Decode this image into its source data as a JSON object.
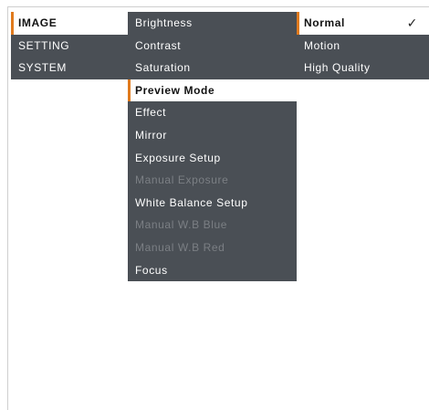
{
  "main_menu": {
    "items": [
      {
        "label": "IMAGE",
        "state": "selected"
      },
      {
        "label": "SETTING",
        "state": "normal"
      },
      {
        "label": "SYSTEM",
        "state": "normal"
      }
    ]
  },
  "image_menu": {
    "items": [
      {
        "label": "Brightness",
        "state": "normal"
      },
      {
        "label": "Contrast",
        "state": "normal"
      },
      {
        "label": "Saturation",
        "state": "normal"
      },
      {
        "label": "Preview Mode",
        "state": "selected"
      },
      {
        "label": "Effect",
        "state": "normal"
      },
      {
        "label": "Mirror",
        "state": "normal"
      },
      {
        "label": "Exposure Setup",
        "state": "normal"
      },
      {
        "label": "Manual Exposure",
        "state": "disabled"
      },
      {
        "label": "White Balance Setup",
        "state": "normal"
      },
      {
        "label": "Manual W.B Blue",
        "state": "disabled"
      },
      {
        "label": "Manual W.B Red",
        "state": "disabled"
      },
      {
        "label": "Focus",
        "state": "normal"
      }
    ]
  },
  "preview_menu": {
    "items": [
      {
        "label": "Normal",
        "state": "selected",
        "checked": true
      },
      {
        "label": "Motion",
        "state": "normal"
      },
      {
        "label": "High Quality",
        "state": "normal"
      }
    ],
    "check_glyph": "✓"
  },
  "colors": {
    "menu_background": "#4a4f55",
    "accent": "#e07a1d",
    "disabled_text": "#7b7f84"
  }
}
